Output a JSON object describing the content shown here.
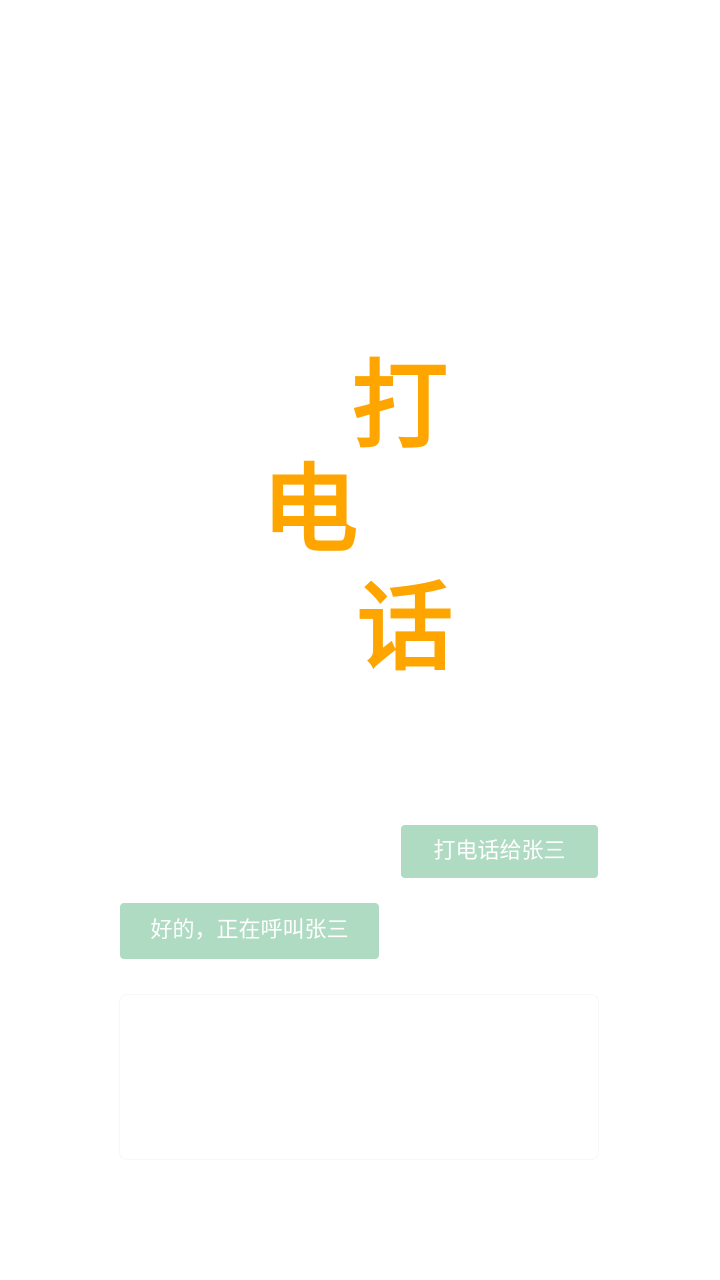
{
  "title": {
    "chars": [
      "打",
      "电",
      "话"
    ],
    "color": "#FFA500"
  },
  "conversation": {
    "user_message": "打电话给张三",
    "assistant_reply": "好的，正在呼叫张三",
    "bubble_color": "#AEDBC2"
  },
  "input": {
    "value": ""
  }
}
